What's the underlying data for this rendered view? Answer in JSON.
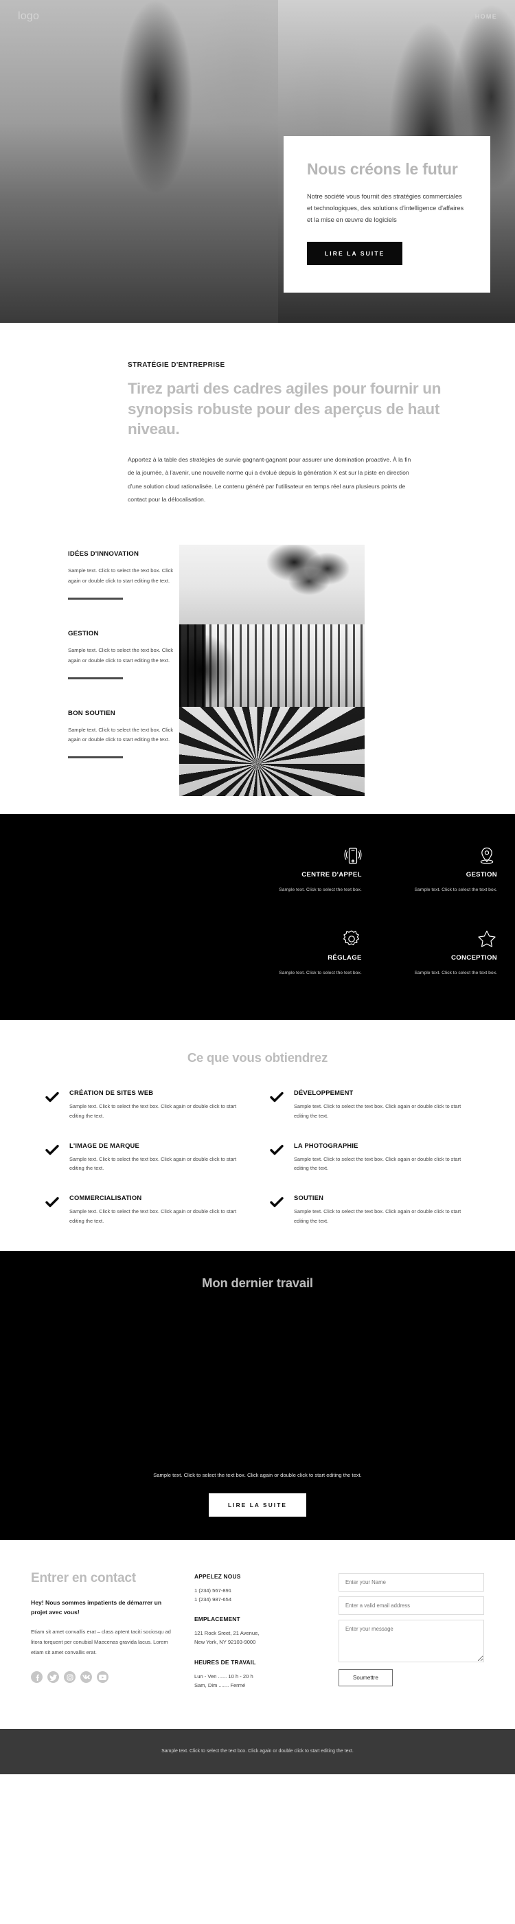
{
  "header": {
    "logo": "logo",
    "nav_home": "HOME"
  },
  "hero": {
    "title": "Nous créons le futur",
    "description": "Notre société vous fournit des stratégies commerciales et technologiques, des solutions d'intelligence d'affaires et la mise en œuvre de logiciels",
    "cta": "LIRE LA SUITE",
    "image_left": "office-presentation-photo",
    "image_right": "team-meeting-photo"
  },
  "strategy": {
    "eyebrow": "STRATÉGIE D'ENTREPRISE",
    "heading": "Tirez parti des cadres agiles pour fournir un synopsis robuste pour des aperçus de haut niveau.",
    "paragraph": "Apportez à la table des stratégies de survie gagnant-gagnant pour assurer une domination proactive. À la fin de la journée, à l'avenir, une nouvelle norme qui a évolué depuis la génération X est sur la piste en direction d'une solution cloud rationalisée. Le contenu généré par l'utilisateur en temps réel aura plusieurs points de contact pour la délocalisation."
  },
  "features": {
    "sample_text": "Sample text. Click to select the text box. Click again or double click to start editing the text.",
    "items": [
      {
        "title": "IDÉES D'INNOVATION",
        "text": "Sample text. Click to select the text box. Click again or double click to start editing the text."
      },
      {
        "title": "GESTION",
        "text": "Sample text. Click to select the text box. Click again or double click to start editing the text."
      },
      {
        "title": "BON SOUTIEN",
        "text": "Sample text. Click to select the text box. Click again or double click to start editing the text."
      }
    ],
    "images": [
      "trees-sky-photo",
      "art-gallery-photo",
      "spiral-staircase-photo"
    ]
  },
  "services": {
    "portrait": "bearded-man-portrait-photo",
    "items": [
      {
        "icon": "mobile-call-icon",
        "title": "CENTRE D'APPEL",
        "text": "Sample text. Click to select the text box."
      },
      {
        "icon": "location-pin-icon",
        "title": "GESTION",
        "text": "Sample text. Click to select the text box."
      },
      {
        "icon": "gear-icon",
        "title": "RÉGLAGE",
        "text": "Sample text. Click to select the text box."
      },
      {
        "icon": "star-icon",
        "title": "CONCEPTION",
        "text": "Sample text. Click to select the text box."
      }
    ]
  },
  "benefits": {
    "heading": "Ce que vous obtiendrez",
    "items": [
      {
        "title": "CRÉATION DE SITES WEB",
        "text": "Sample text. Click to select the text box. Click again or double click to start editing the text."
      },
      {
        "title": "DÉVELOPPEMENT",
        "text": "Sample text. Click to select the text box. Click again or double click to start editing the text."
      },
      {
        "title": "L'IMAGE DE MARQUE",
        "text": "Sample text. Click to select the text box. Click again or double click to start editing the text."
      },
      {
        "title": "LA PHOTOGRAPHIE",
        "text": "Sample text. Click to select the text box. Click again or double click to start editing the text."
      },
      {
        "title": "COMMERCIALISATION",
        "text": "Sample text. Click to select the text box. Click again or double click to start editing the text."
      },
      {
        "title": "SOUTIEN",
        "text": "Sample text. Click to select the text box. Click again or double click to start editing the text."
      }
    ]
  },
  "portfolio": {
    "heading": "Mon dernier travail",
    "note": "Sample text. Click to select the text box. Click again or double click to start editing the text.",
    "cta": "LIRE LA SUITE"
  },
  "contact": {
    "heading": "Entrer en contact",
    "subheading": "Hey! Nous sommes impatients de démarrer un projet avec vous!",
    "body": "Etiam sit amet convallis erat – class aptent taciti sociosqu ad litora torquent per conubial Maecenas gravida lacus. Lorem etiam sit amet convallis erat.",
    "socials": [
      {
        "name": "facebook-icon"
      },
      {
        "name": "twitter-icon"
      },
      {
        "name": "instagram-icon"
      },
      {
        "name": "vk-icon"
      },
      {
        "name": "youtube-icon"
      }
    ],
    "call": {
      "label": "APPELEZ NOUS",
      "phone1": "1 (234) 567-891",
      "phone2": "1 (234) 987-654"
    },
    "location": {
      "label": "EMPLACEMENT",
      "line1": "121 Rock Sreet, 21 Avenue,",
      "line2": "New York, NY 92103-9000"
    },
    "hours": {
      "label": "HEURES DE TRAVAIL",
      "line1": "Lun - Ven ...... 10 h - 20 h",
      "line2": "Sam, Dim ....... Fermé"
    },
    "form": {
      "name_placeholder": "Enter your Name",
      "email_placeholder": "Enter a valid email address",
      "message_placeholder": "Enter your message",
      "submit_label": "Soumettre",
      "name_value": "",
      "email_value": "",
      "message_value": ""
    }
  },
  "footer": {
    "text": "Sample text. Click to select the text box. Click again or double click to start editing the text."
  },
  "colors": {
    "dark": "#000000",
    "footer_bg": "#3a3a3a",
    "muted_heading": "#bcbcbc",
    "body_text": "#3c3c3c"
  }
}
